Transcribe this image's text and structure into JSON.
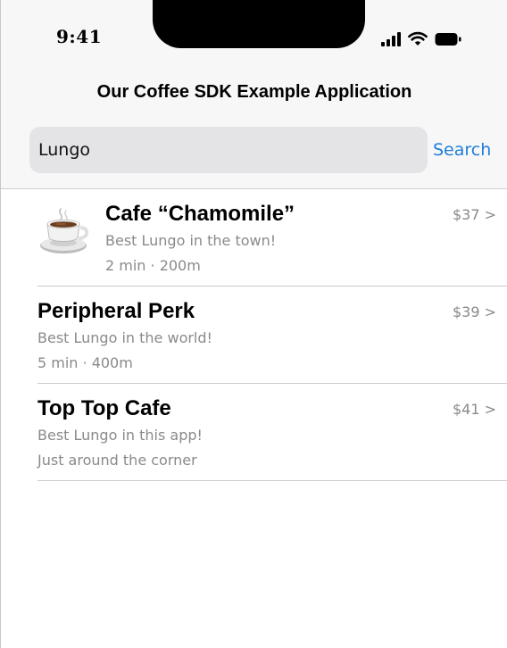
{
  "status_bar": {
    "time": "9:41",
    "icons": [
      "signal-icon",
      "wifi-icon",
      "battery-icon"
    ]
  },
  "header": {
    "title": "Our Coffee SDK Example Application"
  },
  "search": {
    "value": "Lungo",
    "button_label": "Search"
  },
  "results": [
    {
      "name": "Cafe “Chamomile”",
      "description": "Best Lungo in the town!",
      "meta": "2 min · 200m",
      "price": "$37 >",
      "icon": "coffee-cup-icon"
    },
    {
      "name": "Peripheral Perk",
      "description": "Best Lungo in the world!",
      "meta": "5 min · 400m",
      "price": "$39 >"
    },
    {
      "name": "Top Top Cafe",
      "description": "Best Lungo in this app!",
      "meta": "Just around the corner",
      "price": "$41 >"
    }
  ],
  "colors": {
    "accent": "#1f7ed9",
    "secondary_text": "#8a8a8a",
    "search_field_bg": "#e4e4e7",
    "header_bg": "#f7f7f7"
  }
}
